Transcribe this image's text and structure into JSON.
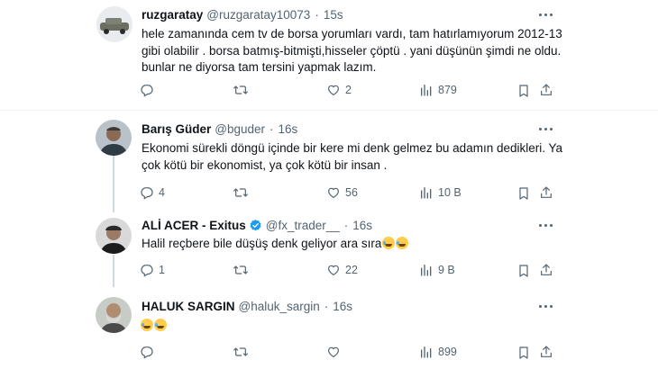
{
  "tweets": [
    {
      "name": "ruzgaratay",
      "handle": "@ruzgaratay10073",
      "separator": "·",
      "time": "15s",
      "avatar": "car-avatar",
      "text": "hele zamanında cem tv de borsa yorumları vardı, tam hatırlamıyorum 2012-13 gibi olabilir .  borsa batmış-bitmişti,hisseler çöptü . yani düşünün şimdi ne oldu. bunlar ne diyorsa tam tersini yapmak lazım.",
      "reply_count": "",
      "retweet_count": "",
      "like_count": "2",
      "view_count": "879"
    },
    {
      "name": "Barış Güder",
      "handle": "@bguder",
      "separator": "·",
      "time": "16s",
      "avatar": "person-avatar",
      "text": "Ekonomi sürekli döngü içinde bir kere mi denk gelmez bu adamın dedikleri. Ya çok kötü bir ekonomist, ya çok kötü bir insan .",
      "reply_count": "4",
      "retweet_count": "",
      "like_count": "56",
      "view_count": "10 B"
    },
    {
      "name": "ALİ ACER - Exitus",
      "handle": "@fx_trader__",
      "separator": "·",
      "time": "16s",
      "avatar": "person-avatar",
      "verified": true,
      "text": "Halil reçbere bile düşüş denk geliyor ara sıra",
      "emoji": [
        "grinning-sweat-emoji",
        "tears-of-joy-emoji"
      ],
      "reply_count": "1",
      "retweet_count": "",
      "like_count": "22",
      "view_count": "9 B"
    },
    {
      "name": "HALUK SARGIN",
      "handle": "@haluk_sargin",
      "separator": "·",
      "time": "16s",
      "avatar": "bearded-person-avatar",
      "text": "",
      "emoji": [
        "tears-of-joy-emoji",
        "tears-of-joy-emoji"
      ],
      "reply_count": "",
      "retweet_count": "",
      "like_count": "",
      "view_count": "899"
    }
  ],
  "icons": {
    "reply": "reply-icon",
    "retweet": "retweet-icon",
    "like": "heart-icon",
    "views": "views-icon",
    "bookmark": "bookmark-icon",
    "share": "share-icon",
    "more": "more-icon",
    "verified": "verified-badge-icon"
  },
  "colors": {
    "text": "#0f1419",
    "secondary": "#536471",
    "verified": "#1d9bf0",
    "divider": "#eff3f4",
    "thread_line": "#cfd9de"
  }
}
